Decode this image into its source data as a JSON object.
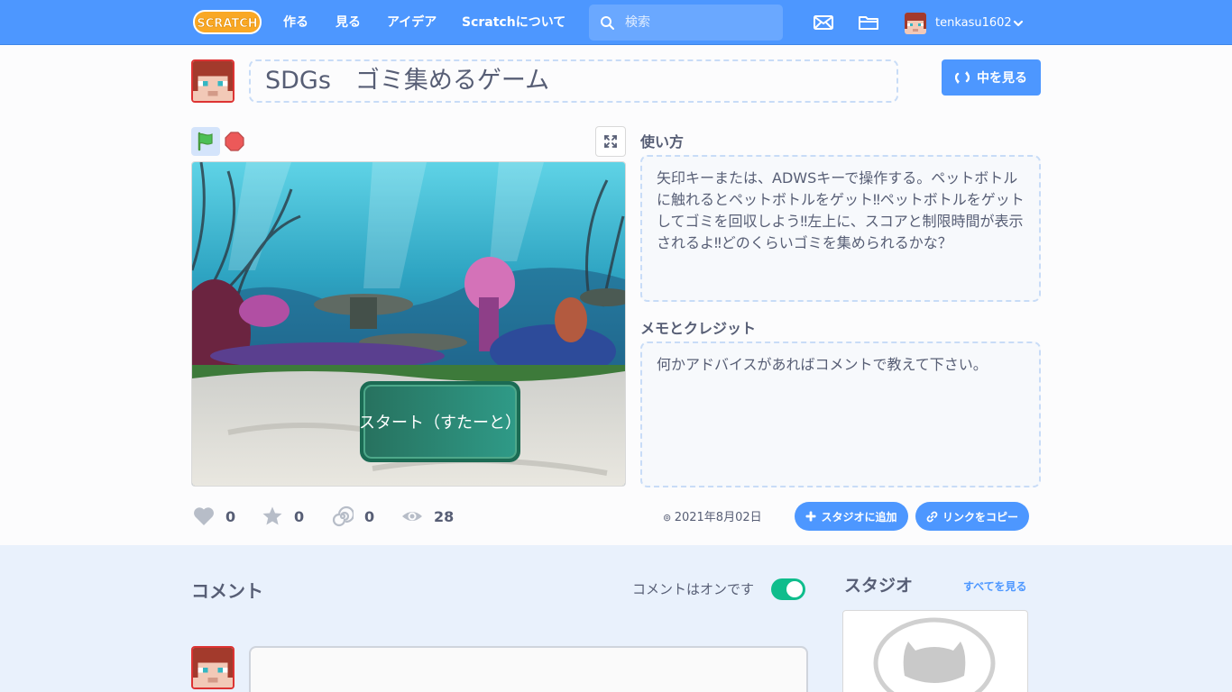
{
  "nav": {
    "logo_text": "SCRATCH",
    "links": [
      "作る",
      "見る",
      "アイデア",
      "Scratchについて"
    ],
    "search_placeholder": "検索",
    "username": "tenkasu1602"
  },
  "project": {
    "title": "SDGs　ゴミ集めるゲーム",
    "see_inside_label": "中を見る",
    "stage_sprite_text": "スタート（すたーと）"
  },
  "stats": {
    "loves": "0",
    "favorites": "0",
    "remixes": "0",
    "views": "28"
  },
  "share": {
    "date": "2021年8月02日",
    "add_to_studio": "スタジオに追加",
    "copy_link": "リンクをコピー"
  },
  "notes": {
    "instructions_label": "使い方",
    "instructions": "矢印キーまたは、ADWSキーで操作する。ペットボトルに触れるとペットボトルをゲット‼ペットボトルをゲットしてゴミを回収しよう‼左上に、スコアと制限時間が表示されるよ‼どのくらいゴミを集められるかな？",
    "credits_label": "メモとクレジット",
    "credits": "何かアドバイスがあればコメントで教えて下さい。"
  },
  "comments": {
    "title": "コメント",
    "status": "コメントはオンです",
    "enabled": true
  },
  "studios": {
    "title": "スタジオ",
    "see_all": "すべてを見る"
  },
  "colors": {
    "brand": "#4d97ff",
    "toggle_on": "#0fbd8c",
    "text": "#575e75"
  }
}
